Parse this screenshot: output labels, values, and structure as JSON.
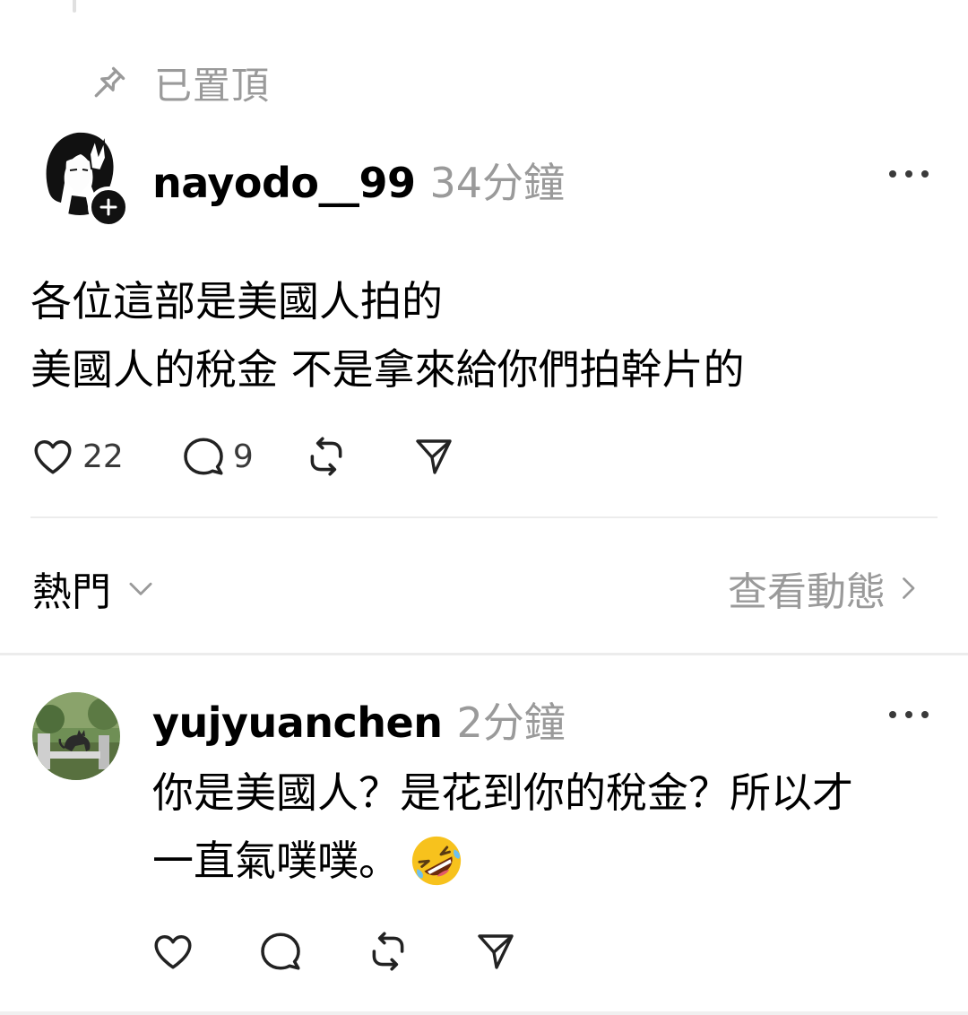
{
  "pinned": {
    "label": "已置頂"
  },
  "post": {
    "username": "nayodo__99",
    "time": "34分鐘",
    "lines": [
      "各位這部是美國人拍的",
      "美國人的稅金 不是拿來給你們拍幹片的"
    ],
    "likes": "22",
    "comments": "9"
  },
  "sort": {
    "label": "熱門",
    "activity": "查看動態"
  },
  "reply": {
    "username": "yujyuanchen",
    "time": "2分鐘",
    "lines": [
      "你是美國人？是花到你的稅金？所以才",
      "一直氣噗噗。"
    ]
  },
  "icons": {
    "pin": "pin-icon",
    "more": "more-icon",
    "like": "heart-icon",
    "comment": "comment-icon",
    "repost": "repost-icon",
    "share": "send-icon",
    "chevron_down": "chevron-down-icon",
    "chevron_right": "chevron-right-icon",
    "emoji": "rolling-on-floor-laughing-emoji",
    "follow": "plus-icon"
  },
  "colors": {
    "text": "#000000",
    "muted": "#9a9a9a",
    "divider": "#ececec",
    "emoji": "#f7c21d"
  }
}
